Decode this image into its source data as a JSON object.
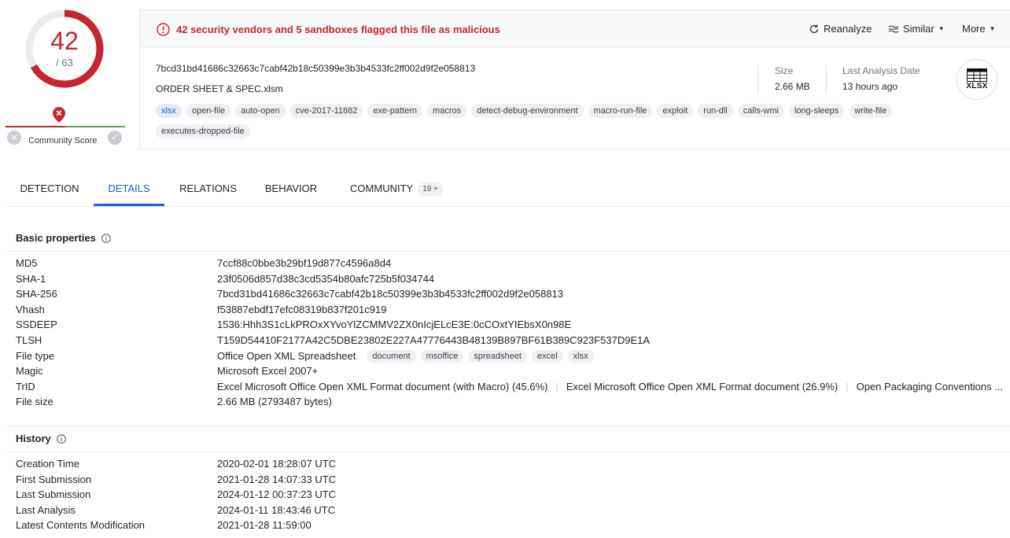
{
  "score": {
    "detections": "42",
    "total": "/ 63",
    "color": "#c6262e",
    "fraction": 0.667
  },
  "community": {
    "label": "Community Score"
  },
  "alert": {
    "text": "42 security vendors and 5 sandboxes flagged this file as malicious"
  },
  "actions": {
    "reanalyze": "Reanalyze",
    "similar": "Similar",
    "more": "More"
  },
  "file": {
    "hash": "7bcd31bd41686c32663c7cabf42b18c50399e3b3b4533fc2ff002d9f2e058813",
    "name": "ORDER SHEET & SPEC.xlsm",
    "size_label": "Size",
    "size_value": "2.66 MB",
    "date_label": "Last Analysis Date",
    "date_value": "13 hours ago",
    "type_badge": "XLSX"
  },
  "tags": [
    "xlsx",
    "open-file",
    "auto-open",
    "cve-2017-11882",
    "exe-pattern",
    "macros",
    "detect-debug-environment",
    "macro-run-file",
    "exploit",
    "run-dll",
    "calls-wmi",
    "long-sleeps",
    "write-file",
    "executes-dropped-file"
  ],
  "tabs": {
    "detection": "DETECTION",
    "details": "DETAILS",
    "relations": "RELATIONS",
    "behavior": "BEHAVIOR",
    "community": "COMMUNITY",
    "community_badge": "19 +"
  },
  "basic": {
    "title": "Basic properties",
    "rows": [
      {
        "label": "MD5",
        "value": "7ccf88c0bbe3b29bf19d877c4596a8d4"
      },
      {
        "label": "SHA-1",
        "value": "23f0506d857d38c3cd5354b80afc725b5f034744"
      },
      {
        "label": "SHA-256",
        "value": "7bcd31bd41686c32663c7cabf42b18c50399e3b3b4533fc2ff002d9f2e058813"
      },
      {
        "label": "Vhash",
        "value": "f53887ebdf17efc08319b837f201c919"
      },
      {
        "label": "SSDEEP",
        "value": "1536:Hhh3S1cLkPROxXYvoYlZCMMV2ZX0nIcjELcE3E:0cCOxtYIEbsX0n98E"
      },
      {
        "label": "TLSH",
        "value": "T159D54410F2177A42C5DBE23802E227A47776443B48139B897BF61B389C923F537D9E1A"
      },
      {
        "label": "File type",
        "value": "Office Open XML Spreadsheet"
      },
      {
        "label": "Magic",
        "value": "Microsoft Excel 2007+"
      },
      {
        "label": "TrID",
        "value": ""
      },
      {
        "label": "File size",
        "value": "2.66 MB (2793487 bytes)"
      }
    ],
    "file_type_tags": [
      "document",
      "msoffice",
      "spreadsheet",
      "excel",
      "xlsx"
    ],
    "trid": [
      "Excel Microsoft Office Open XML Format document (with Macro) (45.6%)",
      "Excel Microsoft Office Open XML Format document (26.9%)",
      "Open Packaging Conventions ..."
    ]
  },
  "history": {
    "title": "History",
    "rows": [
      {
        "label": "Creation Time",
        "value": "2020-02-01 18:28:07 UTC"
      },
      {
        "label": "First Submission",
        "value": "2021-01-28 14:07:33 UTC"
      },
      {
        "label": "Last Submission",
        "value": "2024-01-12 00:37:23 UTC"
      },
      {
        "label": "Last Analysis",
        "value": "2024-01-11 18:43:46 UTC"
      },
      {
        "label": "Latest Contents Modification",
        "value": "2021-01-28 11:59:00"
      }
    ]
  },
  "colors": {
    "malicious": "#c6262e",
    "accent": "#1a5dd3",
    "benign": "#5fa35a"
  }
}
